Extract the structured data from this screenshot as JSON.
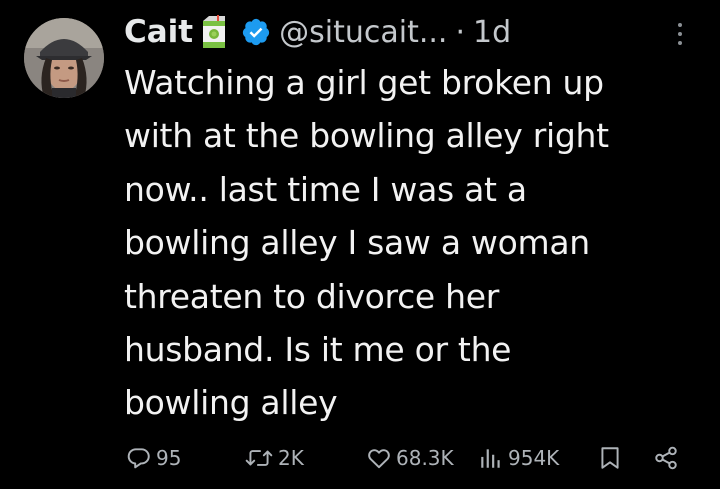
{
  "author": {
    "display_name": "Cait",
    "handle": "@situcait...",
    "separator": "·",
    "timestamp": "1d",
    "name_emoji": "juice-box-emoji",
    "verified": true,
    "verified_color": "#1d9bf0"
  },
  "tweet": {
    "lines": [
      "Watching a girl get broken up",
      "with at the bowling alley right",
      "now.. last time I was at a",
      "bowling alley I saw a woman",
      "threaten to divorce her",
      "husband. Is it me or the",
      "bowling alley"
    ]
  },
  "actions": {
    "replies": "95",
    "reposts": "2K",
    "likes": "68.3K",
    "views": "954K"
  },
  "colors": {
    "background": "#000000",
    "text": "#e7e9ea",
    "secondary": "#aeb3b8"
  }
}
